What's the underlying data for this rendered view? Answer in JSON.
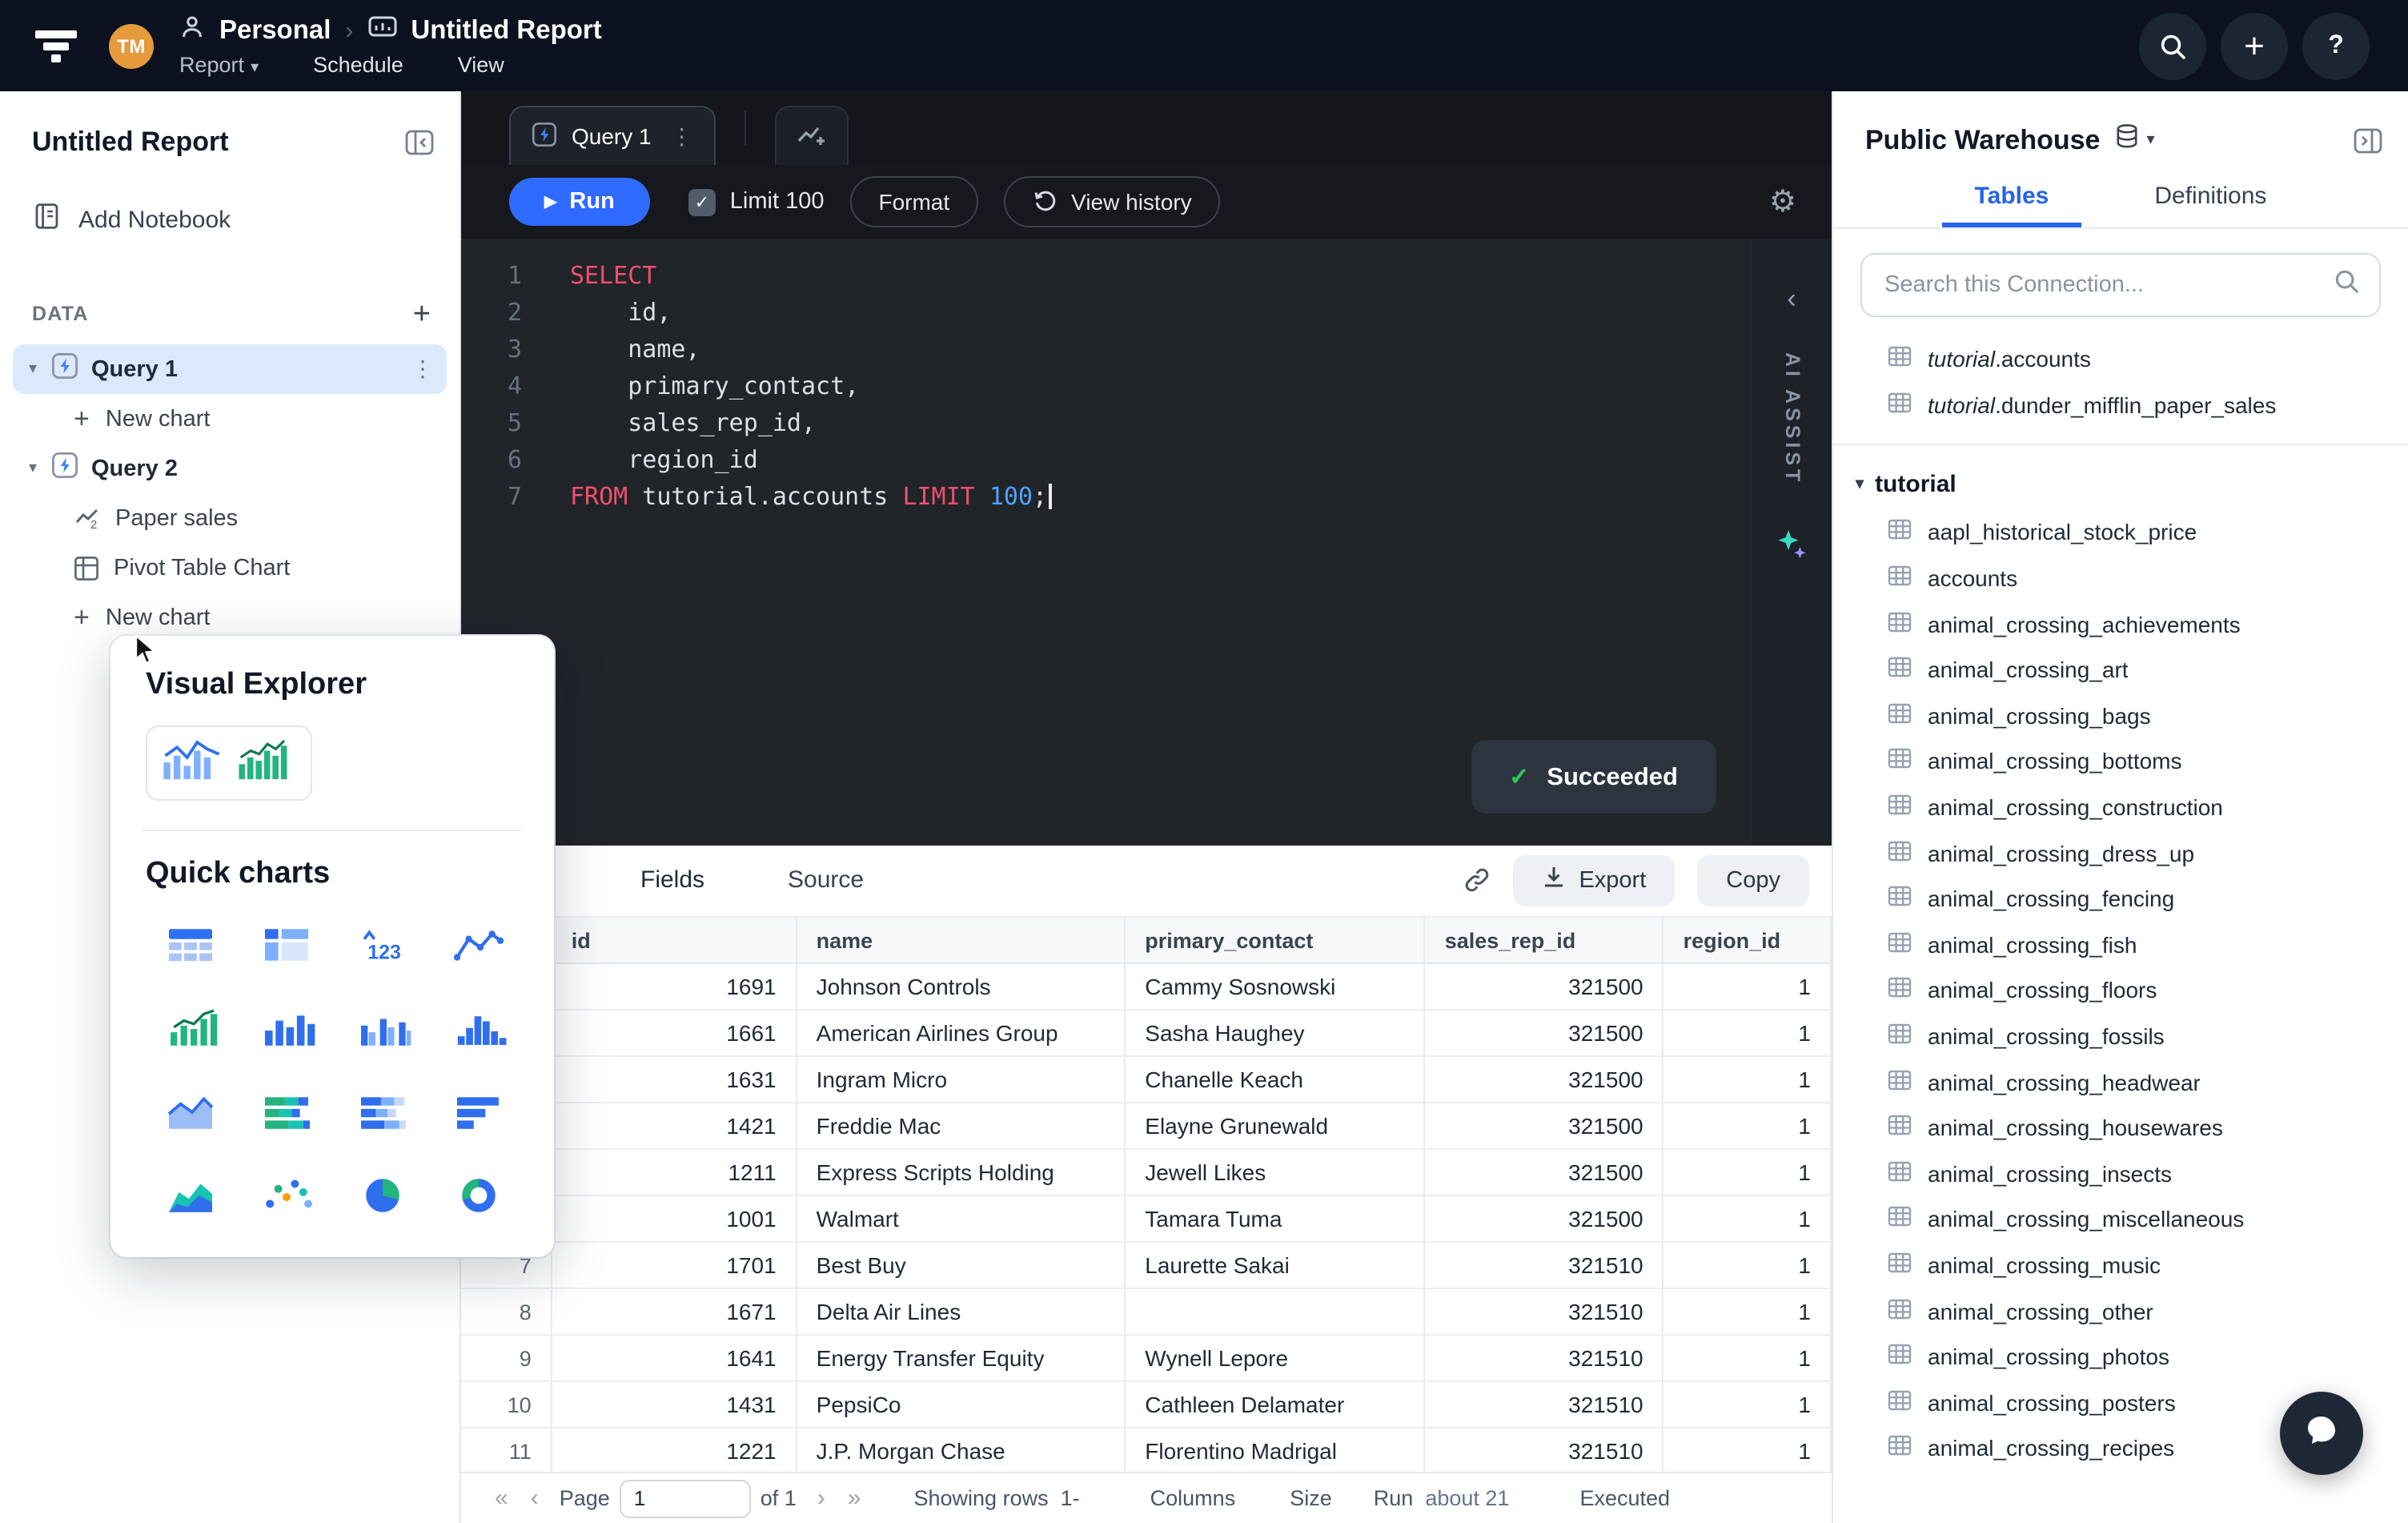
{
  "topbar": {
    "avatar": "TM",
    "personal": "Personal",
    "report": "Report",
    "title": "Untitled Report",
    "schedule": "Schedule",
    "view": "View"
  },
  "left": {
    "title": "Untitled Report",
    "add_notebook": "Add Notebook",
    "data_label": "DATA",
    "query1": "Query 1",
    "query2": "Query 2",
    "paper_sales": "Paper sales",
    "pivot_chart": "Pivot Table Chart",
    "new_chart": "New chart"
  },
  "pop": {
    "title": "Visual Explorer",
    "quick": "Quick charts",
    "icons": [
      "table",
      "pivot-table",
      "single-value",
      "line-chart",
      "trend-bars",
      "column-chart",
      "grouped-column",
      "histogram",
      "area-chart",
      "stacked-rows",
      "stacked-rows-alt",
      "bar-rows",
      "filled-area",
      "scatter",
      "pie",
      "donut"
    ]
  },
  "ed": {
    "tab": "Query 1",
    "run": "Run",
    "limit": "Limit 100",
    "format": "Format",
    "history": "View history",
    "ai": "AI ASSIST",
    "status": "Succeeded",
    "lines": [
      "SELECT",
      "    id,",
      "    name,",
      "    primary_contact,",
      "    sales_rep_id,",
      "    region_id",
      "FROM tutorial.accounts LIMIT 100;"
    ]
  },
  "res": {
    "fields": "Fields",
    "source": "Source",
    "export": "Export",
    "copy": "Copy",
    "columns": [
      "id",
      "name",
      "primary_contact",
      "sales_rep_id",
      "region_id"
    ],
    "rows": [
      [
        "1691",
        "Johnson Controls",
        "Cammy Sosnowski",
        "321500",
        "1"
      ],
      [
        "1661",
        "American Airlines Group",
        "Sasha Haughey",
        "321500",
        "1"
      ],
      [
        "1631",
        "Ingram Micro",
        "Chanelle Keach",
        "321500",
        "1"
      ],
      [
        "1421",
        "Freddie Mac",
        "Elayne Grunewald",
        "321500",
        "1"
      ],
      [
        "1211",
        "Express Scripts Holding",
        "Jewell Likes",
        "321500",
        "1"
      ],
      [
        "1001",
        "Walmart",
        "Tamara Tuma",
        "321500",
        "1"
      ],
      [
        "1701",
        "Best Buy",
        "Laurette Sakai",
        "321510",
        "1"
      ],
      [
        "1671",
        "Delta Air Lines",
        "",
        "321510",
        "1"
      ],
      [
        "1641",
        "Energy Transfer Equity",
        "Wynell Lepore",
        "321510",
        "1"
      ],
      [
        "1431",
        "PepsiCo",
        "Cathleen Delamater",
        "321510",
        "1"
      ],
      [
        "1221",
        "J.P. Morgan Chase",
        "Florentino Madrigal",
        "321510",
        "1"
      ]
    ],
    "footer": {
      "page": "Page",
      "page_value": "1",
      "of": "of 1",
      "showing": "Showing rows",
      "range": "1-",
      "columns": "Columns",
      "size": "Size",
      "run": "Run",
      "run_value": "about 21",
      "executed": "Executed"
    }
  },
  "right": {
    "connection": "Public Warehouse",
    "tab_tables": "Tables",
    "tab_defs": "Definitions",
    "search_placeholder": "Search this Connection...",
    "recent": [
      {
        "prefix": "tutorial",
        "name": ".accounts"
      },
      {
        "prefix": "tutorial",
        "name": ".dunder_mifflin_paper_sales"
      }
    ],
    "group": "tutorial",
    "tables": [
      "aapl_historical_stock_price",
      "accounts",
      "animal_crossing_achievements",
      "animal_crossing_art",
      "animal_crossing_bags",
      "animal_crossing_bottoms",
      "animal_crossing_construction",
      "animal_crossing_dress_up",
      "animal_crossing_fencing",
      "animal_crossing_fish",
      "animal_crossing_floors",
      "animal_crossing_fossils",
      "animal_crossing_headwear",
      "animal_crossing_housewares",
      "animal_crossing_insects",
      "animal_crossing_miscellaneous",
      "animal_crossing_music",
      "animal_crossing_other",
      "animal_crossing_photos",
      "animal_crossing_posters",
      "animal_crossing_recipes"
    ]
  }
}
